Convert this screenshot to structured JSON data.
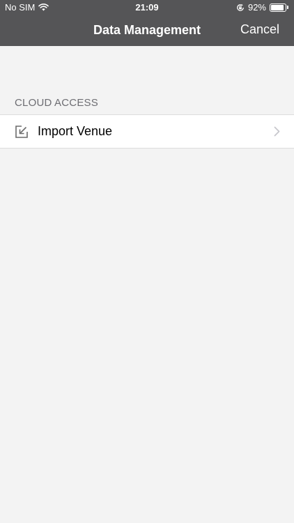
{
  "status_bar": {
    "carrier": "No SIM",
    "time": "21:09",
    "battery_percent": "92%",
    "battery_level": 0.92,
    "icons": [
      "wifi-icon",
      "rotation-lock-icon",
      "battery-icon"
    ]
  },
  "nav": {
    "title": "Data Management",
    "cancel_label": "Cancel"
  },
  "sections": [
    {
      "header": "CLOUD ACCESS",
      "items": [
        {
          "label": "Import Venue",
          "icon": "import-icon"
        }
      ]
    }
  ],
  "colors": {
    "header_bg": "#555557",
    "page_bg": "#f3f3f3",
    "section_header_text": "#6d6d72",
    "row_bg": "#ffffff",
    "separator": "#dcdcdc",
    "chevron": "#c7c7cc"
  }
}
